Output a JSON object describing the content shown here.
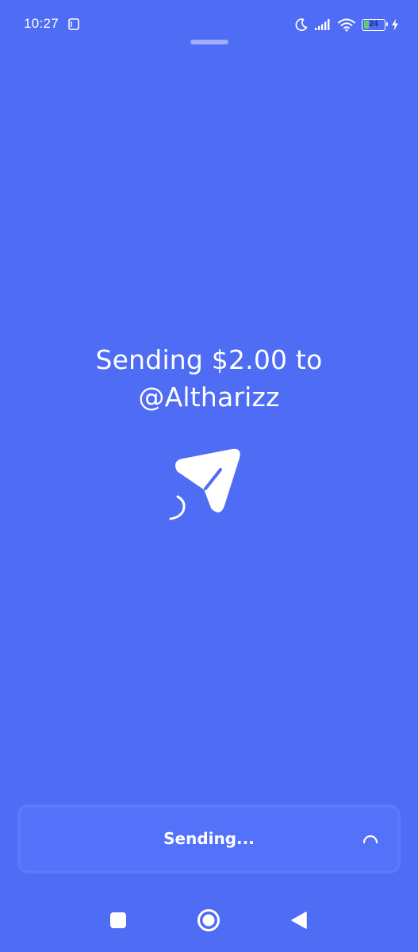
{
  "status_bar": {
    "time": "10:27",
    "battery_level": "24",
    "battery_fill_fraction": 0.24,
    "icons": [
      "notification-card-icon",
      "moon-icon",
      "signal-icon",
      "wifi-icon",
      "battery-icon",
      "charging-bolt-icon"
    ]
  },
  "headline": {
    "line1": "Sending $2.00 to",
    "line2": "@Altharizz"
  },
  "illustration": {
    "icon": "paper-plane-icon"
  },
  "bottom_button": {
    "label": "Sending...",
    "icon": "loading-spinner-icon"
  },
  "nav_bar": {
    "icons": [
      "recent-apps-icon",
      "home-icon",
      "back-icon"
    ]
  },
  "colors": {
    "background": "#4f6cf5",
    "bottom_bar_border": "#5a7bff",
    "battery_fill": "#5fd068",
    "text": "#ffffff"
  }
}
